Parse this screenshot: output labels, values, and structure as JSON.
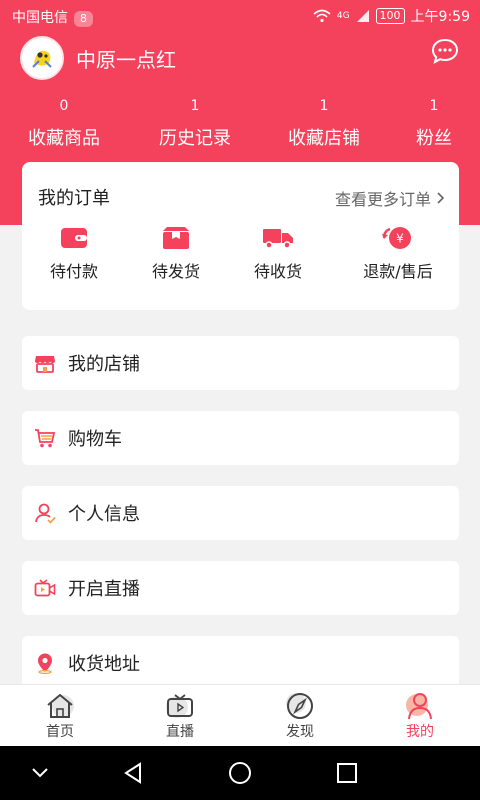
{
  "status_bar": {
    "carrier": "中国电信",
    "notification_count": "8",
    "battery": "100",
    "network": "4G",
    "time": "上午9:59"
  },
  "profile": {
    "username": "中原一点红"
  },
  "stats": [
    {
      "count": "0",
      "label": "收藏商品"
    },
    {
      "count": "1",
      "label": "历史记录"
    },
    {
      "count": "1",
      "label": "收藏店铺"
    },
    {
      "count": "1",
      "label": "粉丝"
    }
  ],
  "orders": {
    "title": "我的订单",
    "more_label": "查看更多订单",
    "items": [
      {
        "label": "待付款",
        "icon": "wallet-icon"
      },
      {
        "label": "待发货",
        "icon": "package-icon"
      },
      {
        "label": "待收货",
        "icon": "truck-icon"
      },
      {
        "label": "退款/售后",
        "icon": "refund-icon"
      }
    ]
  },
  "menu": [
    {
      "label": "我的店铺",
      "icon": "shop-icon"
    },
    {
      "label": "购物车",
      "icon": "cart-icon"
    },
    {
      "label": "个人信息",
      "icon": "user-icon"
    },
    {
      "label": "开启直播",
      "icon": "live-camera-icon"
    },
    {
      "label": "收货地址",
      "icon": "location-icon"
    }
  ],
  "tabs": [
    {
      "label": "首页",
      "icon": "home-icon"
    },
    {
      "label": "直播",
      "icon": "tv-icon"
    },
    {
      "label": "发现",
      "icon": "compass-icon"
    },
    {
      "label": "我的",
      "icon": "profile-icon",
      "active": true
    }
  ],
  "colors": {
    "accent": "#f5425c",
    "background": "#f2f2f2"
  }
}
